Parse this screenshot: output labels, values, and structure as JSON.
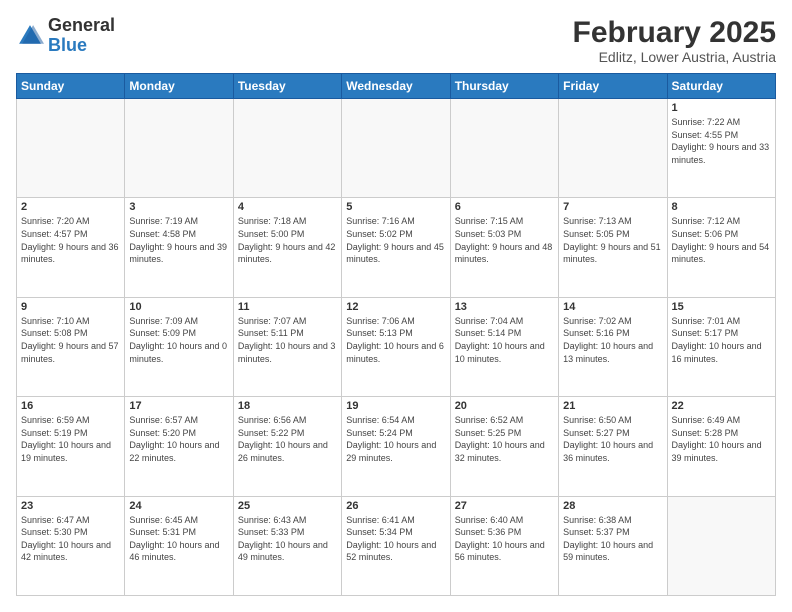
{
  "header": {
    "logo": {
      "general": "General",
      "blue": "Blue"
    },
    "title": "February 2025",
    "subtitle": "Edlitz, Lower Austria, Austria"
  },
  "days_of_week": [
    "Sunday",
    "Monday",
    "Tuesday",
    "Wednesday",
    "Thursday",
    "Friday",
    "Saturday"
  ],
  "weeks": [
    [
      {
        "day": "",
        "info": ""
      },
      {
        "day": "",
        "info": ""
      },
      {
        "day": "",
        "info": ""
      },
      {
        "day": "",
        "info": ""
      },
      {
        "day": "",
        "info": ""
      },
      {
        "day": "",
        "info": ""
      },
      {
        "day": "1",
        "info": "Sunrise: 7:22 AM\nSunset: 4:55 PM\nDaylight: 9 hours and 33 minutes."
      }
    ],
    [
      {
        "day": "2",
        "info": "Sunrise: 7:20 AM\nSunset: 4:57 PM\nDaylight: 9 hours and 36 minutes."
      },
      {
        "day": "3",
        "info": "Sunrise: 7:19 AM\nSunset: 4:58 PM\nDaylight: 9 hours and 39 minutes."
      },
      {
        "day": "4",
        "info": "Sunrise: 7:18 AM\nSunset: 5:00 PM\nDaylight: 9 hours and 42 minutes."
      },
      {
        "day": "5",
        "info": "Sunrise: 7:16 AM\nSunset: 5:02 PM\nDaylight: 9 hours and 45 minutes."
      },
      {
        "day": "6",
        "info": "Sunrise: 7:15 AM\nSunset: 5:03 PM\nDaylight: 9 hours and 48 minutes."
      },
      {
        "day": "7",
        "info": "Sunrise: 7:13 AM\nSunset: 5:05 PM\nDaylight: 9 hours and 51 minutes."
      },
      {
        "day": "8",
        "info": "Sunrise: 7:12 AM\nSunset: 5:06 PM\nDaylight: 9 hours and 54 minutes."
      }
    ],
    [
      {
        "day": "9",
        "info": "Sunrise: 7:10 AM\nSunset: 5:08 PM\nDaylight: 9 hours and 57 minutes."
      },
      {
        "day": "10",
        "info": "Sunrise: 7:09 AM\nSunset: 5:09 PM\nDaylight: 10 hours and 0 minutes."
      },
      {
        "day": "11",
        "info": "Sunrise: 7:07 AM\nSunset: 5:11 PM\nDaylight: 10 hours and 3 minutes."
      },
      {
        "day": "12",
        "info": "Sunrise: 7:06 AM\nSunset: 5:13 PM\nDaylight: 10 hours and 6 minutes."
      },
      {
        "day": "13",
        "info": "Sunrise: 7:04 AM\nSunset: 5:14 PM\nDaylight: 10 hours and 10 minutes."
      },
      {
        "day": "14",
        "info": "Sunrise: 7:02 AM\nSunset: 5:16 PM\nDaylight: 10 hours and 13 minutes."
      },
      {
        "day": "15",
        "info": "Sunrise: 7:01 AM\nSunset: 5:17 PM\nDaylight: 10 hours and 16 minutes."
      }
    ],
    [
      {
        "day": "16",
        "info": "Sunrise: 6:59 AM\nSunset: 5:19 PM\nDaylight: 10 hours and 19 minutes."
      },
      {
        "day": "17",
        "info": "Sunrise: 6:57 AM\nSunset: 5:20 PM\nDaylight: 10 hours and 22 minutes."
      },
      {
        "day": "18",
        "info": "Sunrise: 6:56 AM\nSunset: 5:22 PM\nDaylight: 10 hours and 26 minutes."
      },
      {
        "day": "19",
        "info": "Sunrise: 6:54 AM\nSunset: 5:24 PM\nDaylight: 10 hours and 29 minutes."
      },
      {
        "day": "20",
        "info": "Sunrise: 6:52 AM\nSunset: 5:25 PM\nDaylight: 10 hours and 32 minutes."
      },
      {
        "day": "21",
        "info": "Sunrise: 6:50 AM\nSunset: 5:27 PM\nDaylight: 10 hours and 36 minutes."
      },
      {
        "day": "22",
        "info": "Sunrise: 6:49 AM\nSunset: 5:28 PM\nDaylight: 10 hours and 39 minutes."
      }
    ],
    [
      {
        "day": "23",
        "info": "Sunrise: 6:47 AM\nSunset: 5:30 PM\nDaylight: 10 hours and 42 minutes."
      },
      {
        "day": "24",
        "info": "Sunrise: 6:45 AM\nSunset: 5:31 PM\nDaylight: 10 hours and 46 minutes."
      },
      {
        "day": "25",
        "info": "Sunrise: 6:43 AM\nSunset: 5:33 PM\nDaylight: 10 hours and 49 minutes."
      },
      {
        "day": "26",
        "info": "Sunrise: 6:41 AM\nSunset: 5:34 PM\nDaylight: 10 hours and 52 minutes."
      },
      {
        "day": "27",
        "info": "Sunrise: 6:40 AM\nSunset: 5:36 PM\nDaylight: 10 hours and 56 minutes."
      },
      {
        "day": "28",
        "info": "Sunrise: 6:38 AM\nSunset: 5:37 PM\nDaylight: 10 hours and 59 minutes."
      },
      {
        "day": "",
        "info": ""
      }
    ]
  ]
}
